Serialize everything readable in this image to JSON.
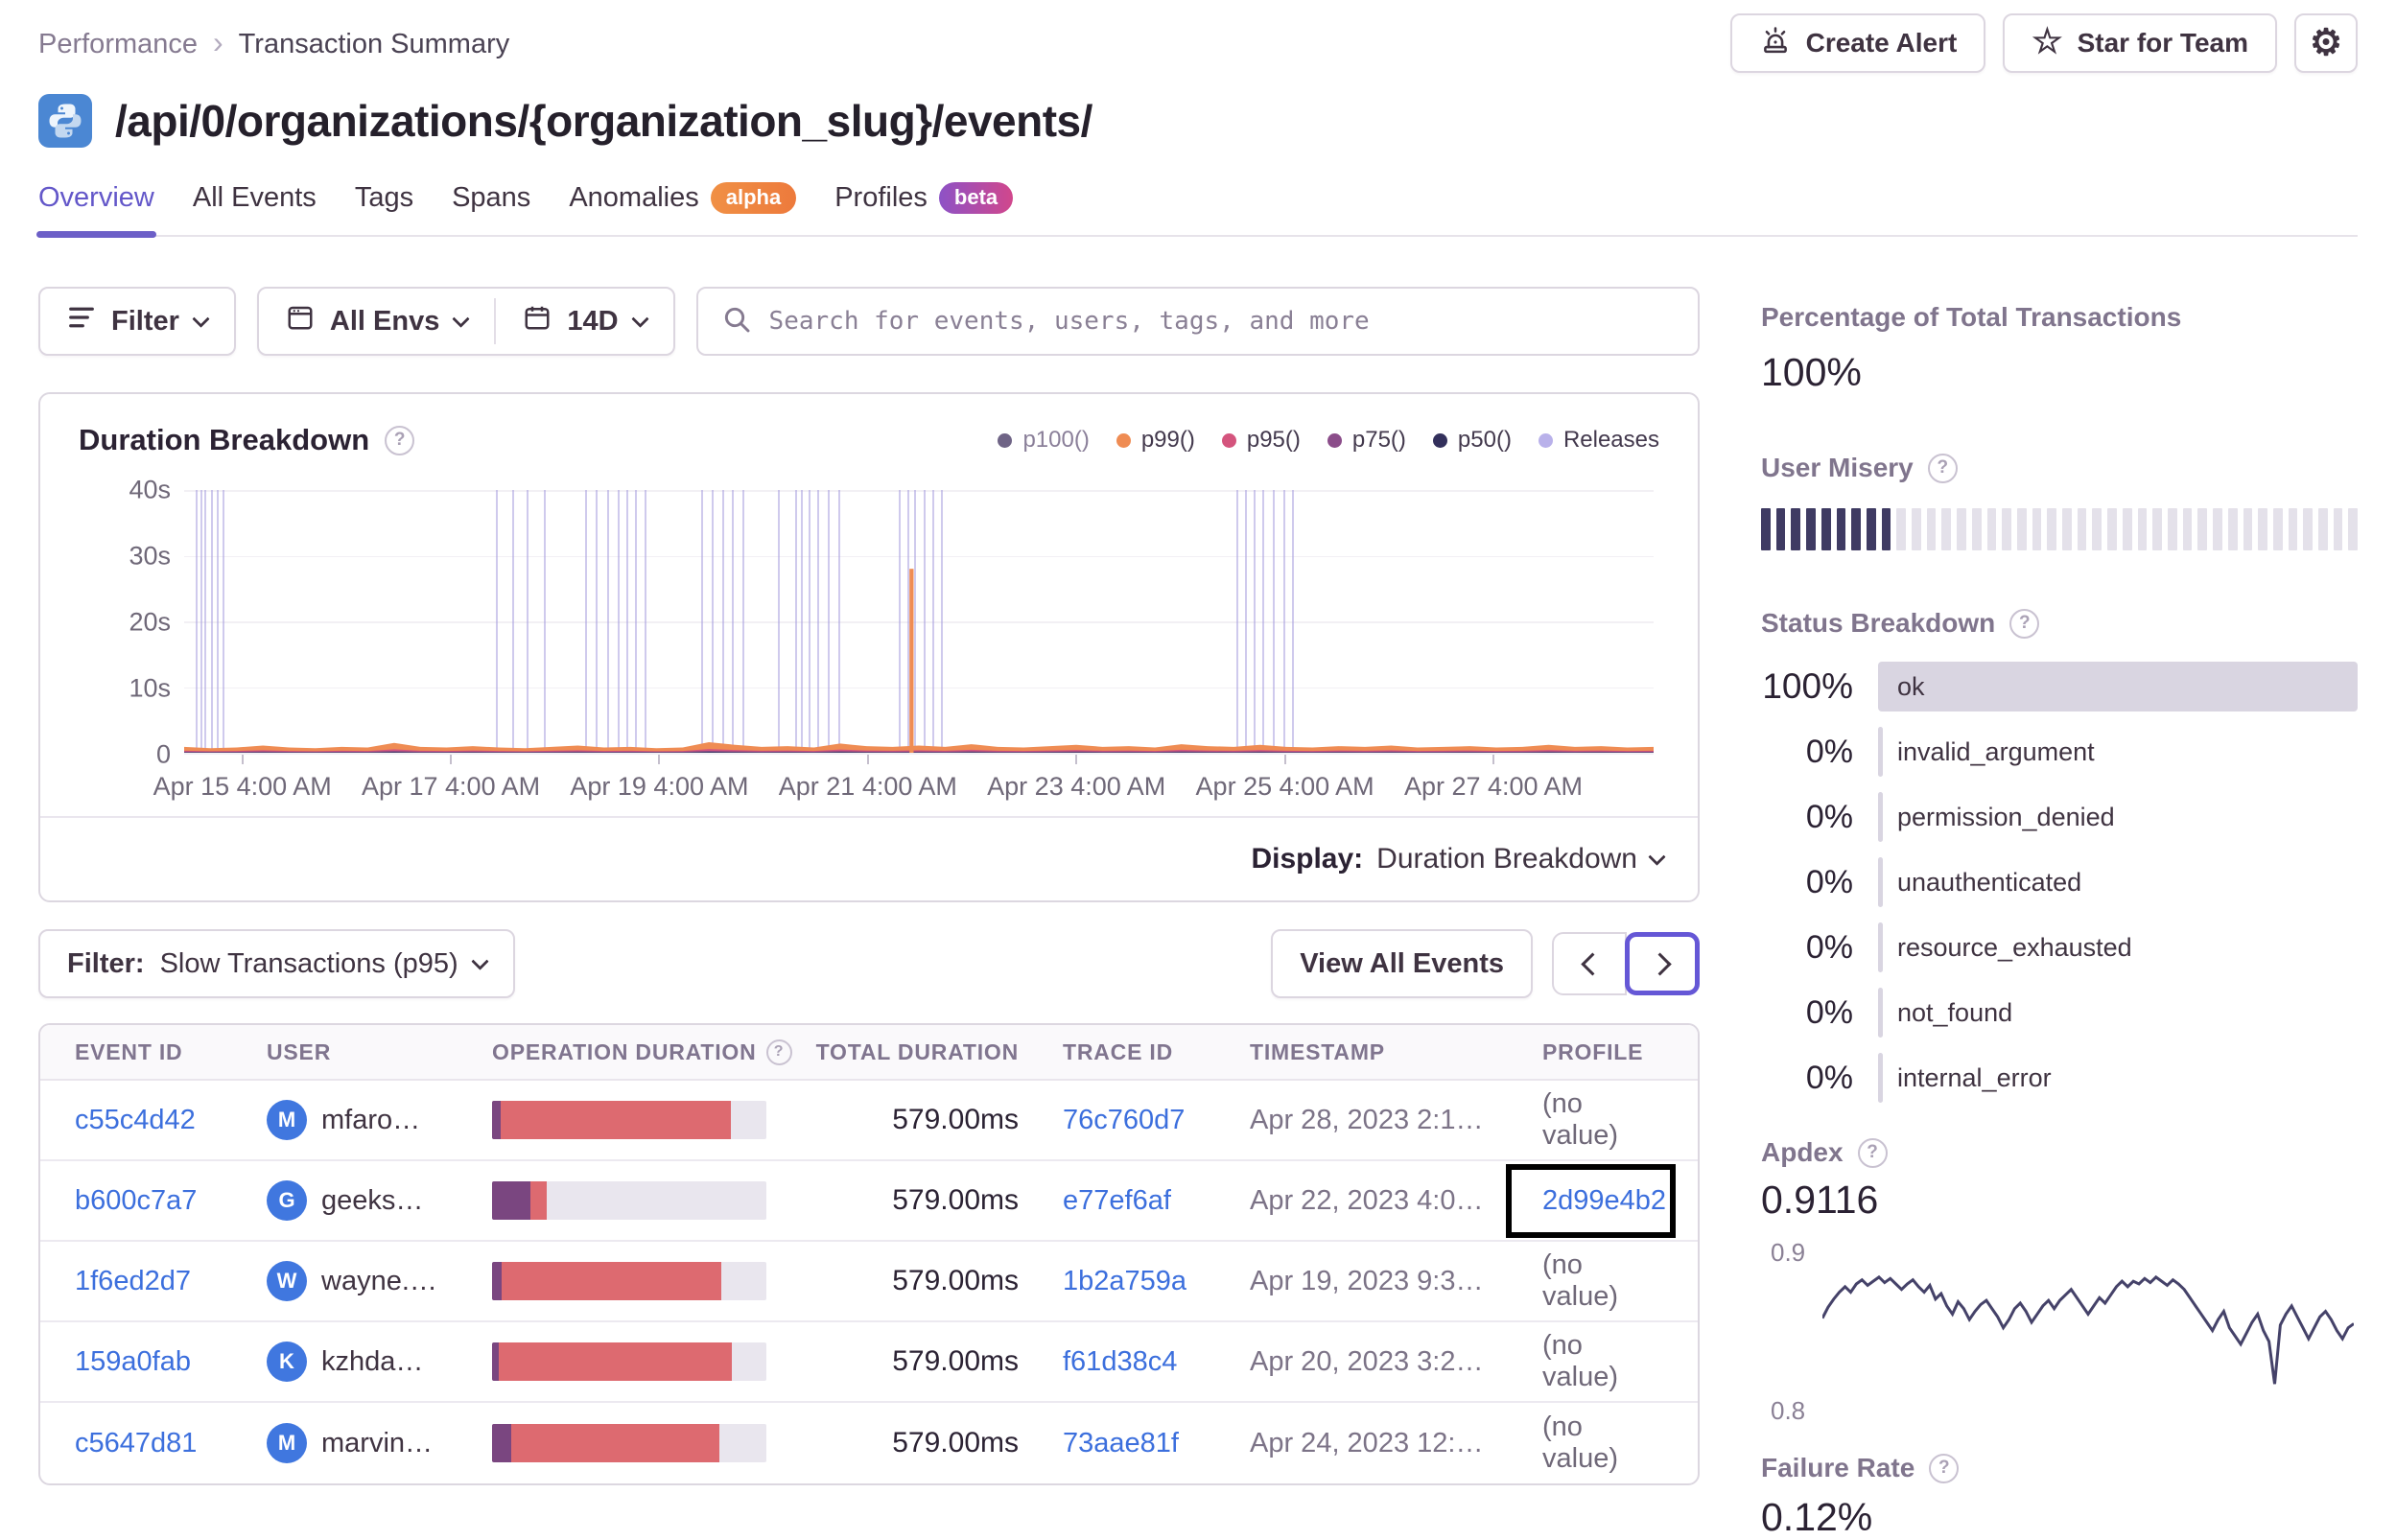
{
  "breadcrumb": {
    "section": "Performance",
    "current": "Transaction Summary"
  },
  "actions": {
    "create_alert": "Create Alert",
    "star_for_team": "Star for Team"
  },
  "page_title": "/api/0/organizations/{organization_slug}/events/",
  "tabs": [
    {
      "label": "Overview",
      "active": true
    },
    {
      "label": "All Events"
    },
    {
      "label": "Tags"
    },
    {
      "label": "Spans"
    },
    {
      "label": "Anomalies",
      "badge": "alpha"
    },
    {
      "label": "Profiles",
      "badge": "beta"
    }
  ],
  "filter_bar": {
    "filter_label": "Filter",
    "envs_label": "All Envs",
    "date_label": "14D",
    "search_placeholder": "Search for events, users, tags, and more"
  },
  "chart_card": {
    "title": "Duration Breakdown",
    "display_label": "Display:",
    "display_value": "Duration Breakdown"
  },
  "events_toolbar": {
    "filter_label": "Filter:",
    "filter_value": "Slow Transactions (p95)",
    "view_all": "View All Events"
  },
  "table": {
    "columns": [
      "EVENT ID",
      "USER",
      "OPERATION DURATION",
      "TOTAL DURATION",
      "TRACE ID",
      "TIMESTAMP",
      "PROFILE"
    ],
    "rows": [
      {
        "event_id": "c55c4d42",
        "user_initial": "M",
        "user": "mfaro…",
        "bar": {
          "purple_pct": 3,
          "red_pct": 84
        },
        "total": "579.00ms",
        "trace_id": "76c760d7",
        "timestamp": "Apr 28, 2023 2:1…",
        "profile": "(no value)",
        "profile_link": false,
        "highlighted": false
      },
      {
        "event_id": "b600c7a7",
        "user_initial": "G",
        "user": "geeks…",
        "bar": {
          "purple_pct": 14,
          "red_pct": 6
        },
        "total": "579.00ms",
        "trace_id": "e77ef6af",
        "timestamp": "Apr 22, 2023 4:0…",
        "profile": "2d99e4b2",
        "profile_link": true,
        "highlighted": true
      },
      {
        "event_id": "1f6ed2d7",
        "user_initial": "W",
        "user": "wayne.…",
        "bar": {
          "purple_pct": 3.5,
          "red_pct": 80
        },
        "total": "579.00ms",
        "trace_id": "1b2a759a",
        "timestamp": "Apr 19, 2023 9:3…",
        "profile": "(no value)",
        "profile_link": false,
        "highlighted": false
      },
      {
        "event_id": "159a0fab",
        "user_initial": "K",
        "user": "kzhda…",
        "bar": {
          "purple_pct": 2.5,
          "red_pct": 85
        },
        "total": "579.00ms",
        "trace_id": "f61d38c4",
        "timestamp": "Apr 20, 2023 3:2…",
        "profile": "(no value)",
        "profile_link": false,
        "highlighted": false
      },
      {
        "event_id": "c5647d81",
        "user_initial": "M",
        "user": "marvin…",
        "bar": {
          "purple_pct": 7,
          "red_pct": 76
        },
        "total": "579.00ms",
        "trace_id": "73aae81f",
        "timestamp": "Apr 24, 2023 12:…",
        "profile": "(no value)",
        "profile_link": false,
        "highlighted": false
      }
    ]
  },
  "sidebar": {
    "percent_total": {
      "heading": "Percentage of Total Transactions",
      "value": "100%"
    },
    "user_misery": {
      "heading": "User Misery",
      "segments": 40,
      "filled": 9,
      "fill_color": "#3f3b63",
      "empty_color": "#e4e1ea"
    },
    "status_breakdown": {
      "heading": "Status Breakdown",
      "items": [
        {
          "pct": "100%",
          "label": "ok",
          "bar_pct": 100
        },
        {
          "pct": "0%",
          "label": "invalid_argument",
          "bar_pct": 0
        },
        {
          "pct": "0%",
          "label": "permission_denied",
          "bar_pct": 0
        },
        {
          "pct": "0%",
          "label": "unauthenticated",
          "bar_pct": 0
        },
        {
          "pct": "0%",
          "label": "resource_exhausted",
          "bar_pct": 0
        },
        {
          "pct": "0%",
          "label": "not_found",
          "bar_pct": 0
        },
        {
          "pct": "0%",
          "label": "internal_error",
          "bar_pct": 0
        }
      ]
    },
    "apdex": {
      "heading": "Apdex",
      "value": "0.9116"
    },
    "failure_rate": {
      "heading": "Failure Rate",
      "value": "0.12%"
    }
  },
  "colors": {
    "accent_purple": "#6c5fc7",
    "link_blue": "#3c6fdd",
    "bar_red": "#dd6a70",
    "bar_purple": "#7a4680",
    "release_lavender": "#a79ede",
    "badge_alpha": "#ee7a3c",
    "badge_beta_start": "#8d52c6",
    "badge_beta_end": "#d1478c"
  },
  "chart_data": [
    {
      "id": "duration_breakdown",
      "type": "area",
      "title": "Duration Breakdown",
      "legend": [
        {
          "name": "p100()",
          "color": "#6f6486",
          "muted": true
        },
        {
          "name": "p99()",
          "color": "#ef8c53"
        },
        {
          "name": "p95()",
          "color": "#d4547d"
        },
        {
          "name": "p75()",
          "color": "#8b4d8a"
        },
        {
          "name": "p50()",
          "color": "#33305c"
        },
        {
          "name": "Releases",
          "color": "#b9b1ea"
        }
      ],
      "ylim": [
        0,
        40
      ],
      "yticks": [
        {
          "label": "40s",
          "pct": 0
        },
        {
          "label": "30s",
          "pct": 25
        },
        {
          "label": "20s",
          "pct": 50
        },
        {
          "label": "10s",
          "pct": 75
        },
        {
          "label": "0",
          "pct": 100
        }
      ],
      "xticks": [
        "Apr 15 4:00 AM",
        "Apr 17 4:00 AM",
        "Apr 19 4:00 AM",
        "Apr 21 4:00 AM",
        "Apr 23 4:00 AM",
        "Apr 25 4:00 AM",
        "Apr 27 4:00 AM"
      ],
      "xtick_pct": [
        3.96,
        18.15,
        32.34,
        46.53,
        60.72,
        74.91,
        89.1
      ],
      "p99_seconds": [
        0.9,
        0.7,
        0.8,
        1.1,
        0.8,
        0.7,
        0.9,
        0.8,
        1.5,
        0.9,
        0.8,
        1.0,
        0.8,
        0.7,
        0.9,
        1.1,
        0.8,
        0.9,
        0.7,
        0.8,
        1.6,
        1.2,
        0.9,
        1.0,
        0.8,
        1.4,
        1.0,
        0.9,
        1.1,
        0.9,
        1.3,
        0.9,
        0.8,
        1.0,
        1.2,
        0.9,
        1.0,
        0.8,
        1.3,
        1.0,
        0.9,
        1.2,
        0.9,
        0.8,
        1.0,
        0.9,
        1.1,
        0.8,
        0.9,
        1.0,
        0.8,
        0.9,
        1.2,
        0.9,
        1.0,
        0.8,
        0.9
      ],
      "spike": {
        "x_pct": 49.5,
        "value_seconds": 28
      },
      "releases_x_pct": [
        0.8,
        1.1,
        1.4,
        1.8,
        2.2,
        2.6,
        21.2,
        22.3,
        23.3,
        24.5,
        27.3,
        28.0,
        28.8,
        29.5,
        30.1,
        30.7,
        31.3,
        35.2,
        35.9,
        36.6,
        37.3,
        38.0,
        40.4,
        41.6,
        42.0,
        42.5,
        43.1,
        43.8,
        44.5,
        48.6,
        49.2,
        49.7,
        50.3,
        50.9,
        51.5,
        71.6,
        72.2,
        72.8,
        73.4,
        74.1,
        74.8,
        75.4
      ]
    },
    {
      "id": "apdex_trend",
      "type": "line",
      "line_color": "#454269",
      "ylim": [
        0.78,
        0.92
      ],
      "yticks": [
        "0.9",
        "0.8"
      ],
      "values": [
        0.86,
        0.868,
        0.874,
        0.879,
        0.883,
        0.879,
        0.885,
        0.888,
        0.884,
        0.887,
        0.89,
        0.886,
        0.889,
        0.885,
        0.881,
        0.885,
        0.888,
        0.883,
        0.879,
        0.884,
        0.874,
        0.878,
        0.869,
        0.863,
        0.872,
        0.867,
        0.859,
        0.865,
        0.87,
        0.873,
        0.867,
        0.861,
        0.853,
        0.859,
        0.867,
        0.871,
        0.865,
        0.857,
        0.863,
        0.869,
        0.873,
        0.867,
        0.873,
        0.877,
        0.881,
        0.875,
        0.869,
        0.863,
        0.869,
        0.875,
        0.871,
        0.877,
        0.883,
        0.887,
        0.883,
        0.887,
        0.885,
        0.889,
        0.886,
        0.89,
        0.887,
        0.884,
        0.888,
        0.885,
        0.881,
        0.875,
        0.869,
        0.863,
        0.857,
        0.851,
        0.859,
        0.865,
        0.853,
        0.847,
        0.841,
        0.849,
        0.857,
        0.863,
        0.851,
        0.843,
        0.812,
        0.855,
        0.863,
        0.869,
        0.861,
        0.853,
        0.845,
        0.853,
        0.861,
        0.865,
        0.859,
        0.851,
        0.845,
        0.853,
        0.856
      ]
    }
  ]
}
